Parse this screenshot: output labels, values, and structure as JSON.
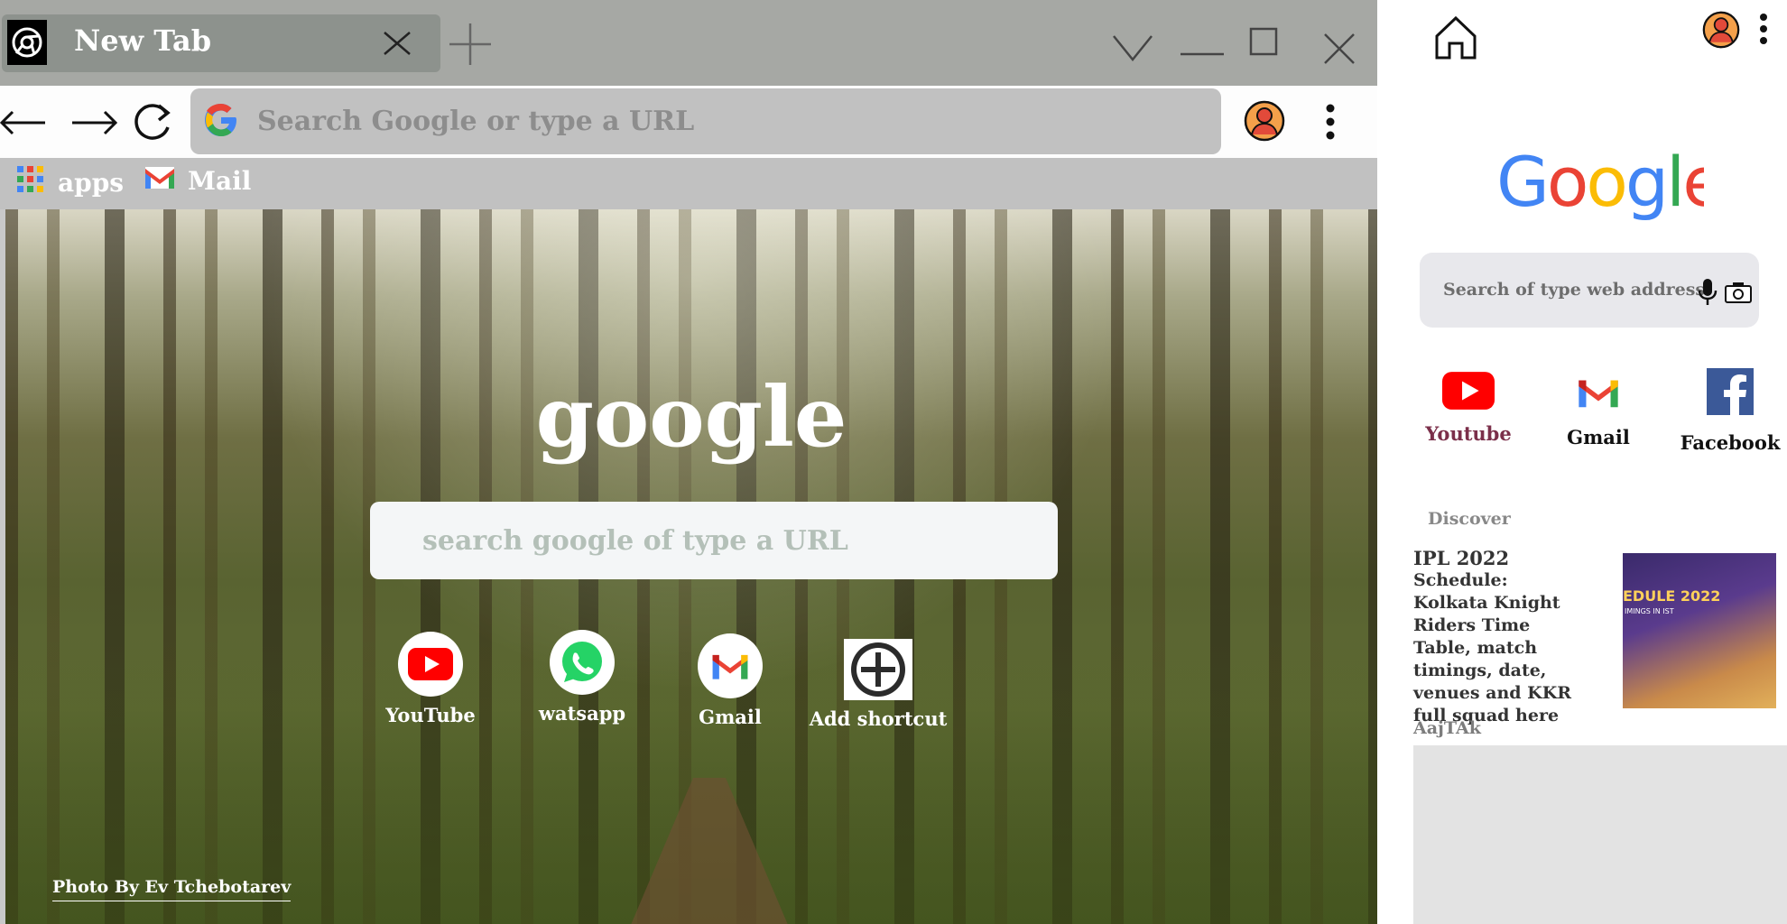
{
  "browser": {
    "tab": {
      "title": "New Tab"
    },
    "omnibox": {
      "placeholder": "Search Google or type a URL"
    },
    "bookmarks": [
      {
        "label": "apps",
        "icon": "apps-grid-icon"
      },
      {
        "label": "Mail",
        "icon": "gmail-icon"
      }
    ]
  },
  "new_tab_page": {
    "logo": "google",
    "search_placeholder": "search google of type a URL",
    "shortcuts": [
      {
        "label": "YouTube",
        "icon": "youtube-icon"
      },
      {
        "label": "watsapp",
        "icon": "whatsapp-icon"
      },
      {
        "label": "Gmail",
        "icon": "gmail-icon"
      },
      {
        "label": "Add shortcut",
        "icon": "plus-icon"
      }
    ],
    "photo_credit": "Photo By Ev Tchebotarev"
  },
  "mobile": {
    "search_placeholder": "Search of type web address",
    "shortcuts": [
      {
        "label": "Youtube",
        "icon": "youtube-icon"
      },
      {
        "label": "Gmail",
        "icon": "gmail-icon"
      },
      {
        "label": "Facebook",
        "icon": "facebook-icon"
      }
    ],
    "discover": {
      "heading": "Discover",
      "article": {
        "title": "IPL 2022",
        "body": "Schedule: Kolkata Knight Riders Time Table, match timings, date, venues and KKR full squad here",
        "source": "AajTAk",
        "thumbnail_text": "EDULE 2022",
        "thumbnail_subtext": "IMINGS IN IST"
      }
    }
  },
  "colors": {
    "tab_bar": "#a6a8a4",
    "active_tab": "#8d928d",
    "omnibox": "#c1c1c1",
    "youtube_red": "#ff0000",
    "whatsapp_green": "#25d366",
    "facebook_blue": "#3b5998"
  }
}
